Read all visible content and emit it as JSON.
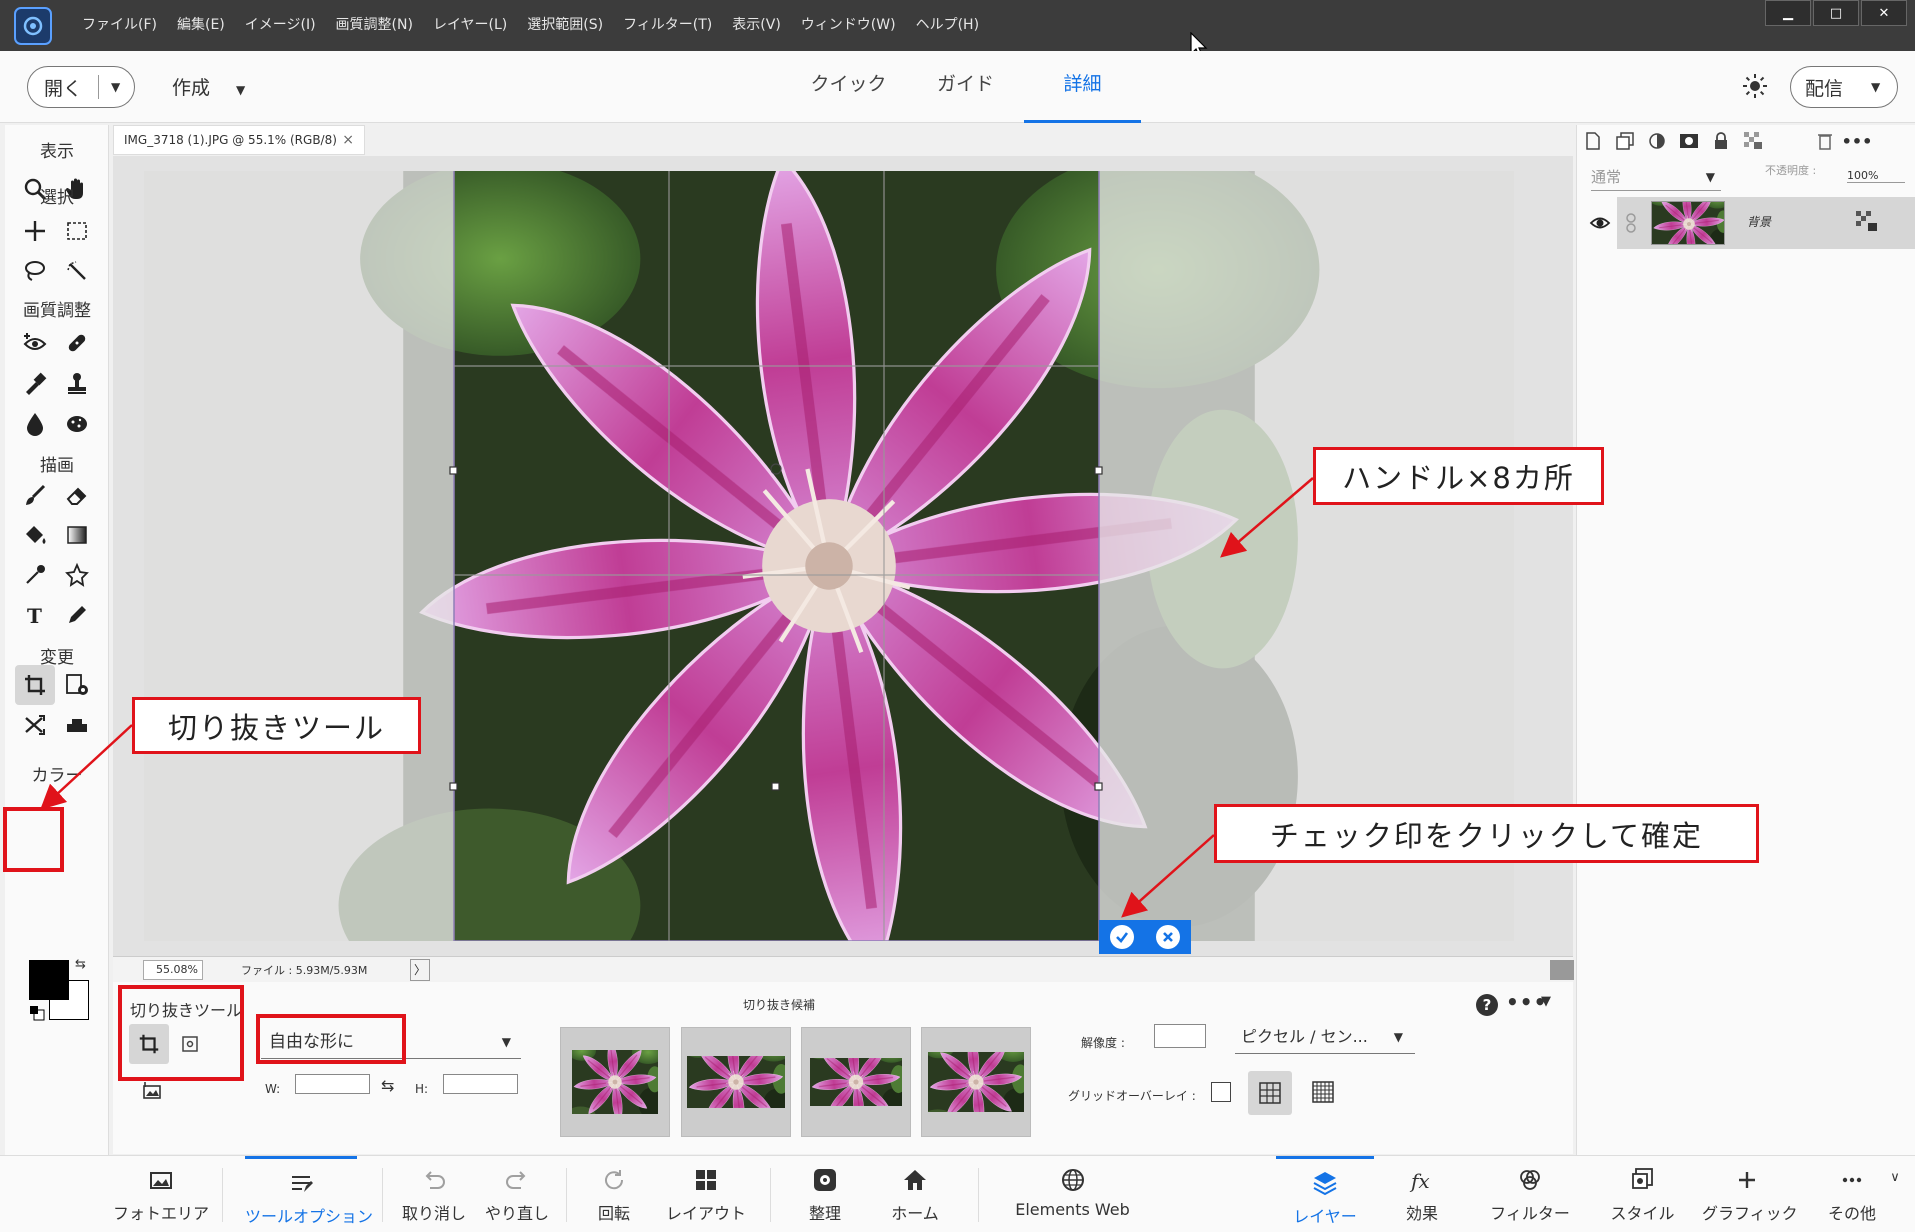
{
  "menu": [
    "ファイル(F)",
    "編集(E)",
    "イメージ(I)",
    "画質調整(N)",
    "レイヤー(L)",
    "選択範囲(S)",
    "フィルター(T)",
    "表示(V)",
    "ウィンドウ(W)",
    "ヘルプ(H)"
  ],
  "window_controls": {
    "minimize": "▁",
    "maximize": "□",
    "close": "✕"
  },
  "header": {
    "open_label": "開く",
    "create_label": "作成",
    "modes": [
      "クイック",
      "ガイド",
      "詳細"
    ],
    "active_mode": "詳細",
    "share_label": "配信"
  },
  "toolbox": {
    "sections": {
      "view": "表示",
      "select": "選択",
      "enhance": "画質調整",
      "draw": "描画",
      "modify": "変更",
      "color": "カラー"
    }
  },
  "document": {
    "tab_title": "IMG_3718 (1).JPG @ 55.1% (RGB/8)",
    "tab_close": "×",
    "zoom": "55.08%",
    "file_info": "ファイル : 5.93M/5.93M",
    "status_arrow": "〉"
  },
  "tool_options": {
    "tool_name": "切り抜きツール",
    "preset": "自由な形に",
    "w_label": "W:",
    "h_label": "H:",
    "w_value": "",
    "h_value": "",
    "candidates_label": "切り抜き候補",
    "resolution_label": "解像度 :",
    "resolution_value": "",
    "unit": "ピクセル / セン...",
    "grid_overlay_label": "グリッドオーバーレイ :",
    "help": "?",
    "more": "•••"
  },
  "layers_panel": {
    "blend_mode": "通常",
    "opacity_label": "不透明度 :",
    "opacity_value": "100%",
    "layer_name": "背景"
  },
  "taskbar": [
    {
      "label": "フォトエリア",
      "icon": "photo-bin-icon"
    },
    {
      "label": "ツールオプション",
      "icon": "tool-options-icon",
      "active": true
    },
    {
      "label": "取り消し",
      "icon": "undo-icon"
    },
    {
      "label": "やり直し",
      "icon": "redo-icon"
    },
    {
      "label": "回転",
      "icon": "rotate-icon"
    },
    {
      "label": "レイアウト",
      "icon": "layout-icon"
    },
    {
      "label": "整理",
      "icon": "organizer-icon"
    },
    {
      "label": "ホーム",
      "icon": "home-icon"
    },
    {
      "label": "Elements Web",
      "icon": "globe-icon"
    },
    {
      "label": "レイヤー",
      "icon": "layers-icon",
      "active": true
    },
    {
      "label": "効果",
      "icon": "fx-icon"
    },
    {
      "label": "フィルター",
      "icon": "filter-icon"
    },
    {
      "label": "スタイル",
      "icon": "styles-icon"
    },
    {
      "label": "グラフィック",
      "icon": "graphics-icon"
    },
    {
      "label": "その他",
      "icon": "more-icon"
    }
  ],
  "annotations": {
    "crop_tool": "切り抜きツール",
    "handles": "ハンドル×8カ所",
    "confirm": "チェック印をクリックして確定"
  },
  "colors": {
    "accent": "#1473e6",
    "callout": "#e0131a",
    "foreground": "#000000",
    "background": "#ffffff"
  }
}
